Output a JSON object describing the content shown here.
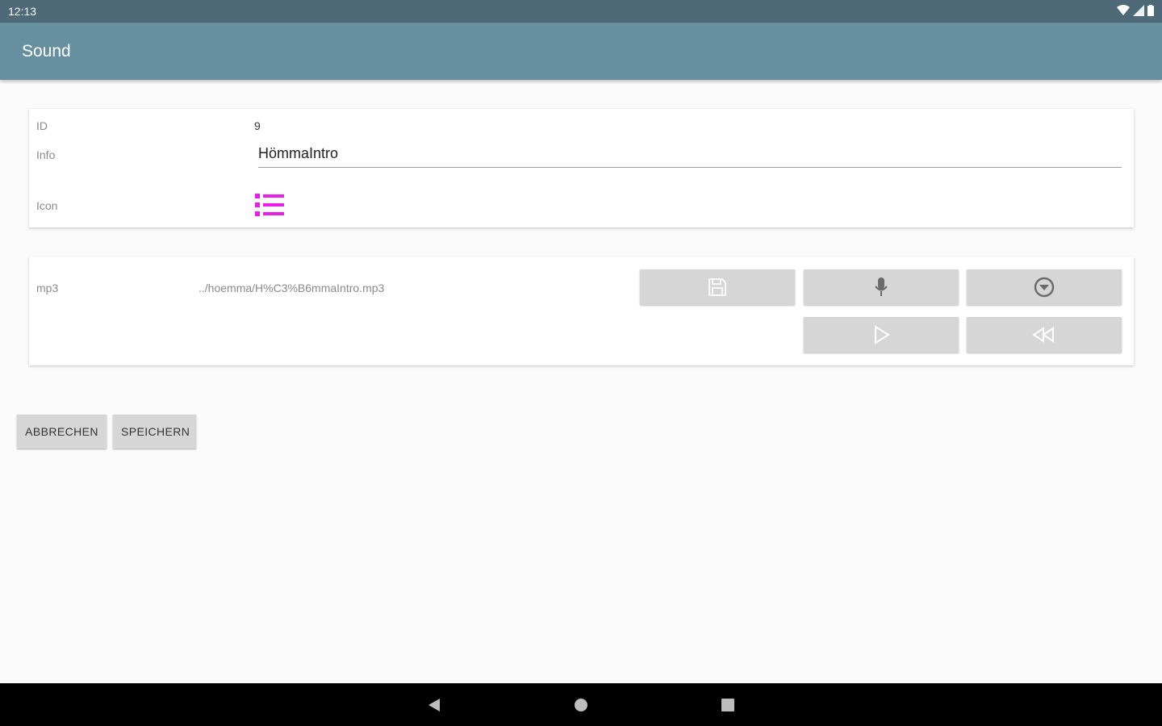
{
  "status_bar": {
    "time": "12:13",
    "icons": [
      "wifi-icon",
      "signal-icon",
      "battery-icon"
    ]
  },
  "app_bar": {
    "title": "Sound"
  },
  "details": {
    "id_label": "ID",
    "id_value": "9",
    "info_label": "Info",
    "info_value": "HömmaIntro",
    "icon_label": "Icon",
    "icon_name": "list-icon",
    "icon_color": "#e91ee9"
  },
  "mp3": {
    "label": "mp3",
    "path": "../hoemma/H%C3%B6mmaIntro.mp3",
    "buttons": [
      "save-icon",
      "microphone-icon",
      "download-circle-icon",
      "play-icon",
      "rewind-icon"
    ]
  },
  "actions": {
    "cancel": "ABBRECHEN",
    "save": "SPEICHERN"
  },
  "nav": {
    "buttons": [
      "back-icon",
      "home-icon",
      "recents-icon"
    ]
  }
}
